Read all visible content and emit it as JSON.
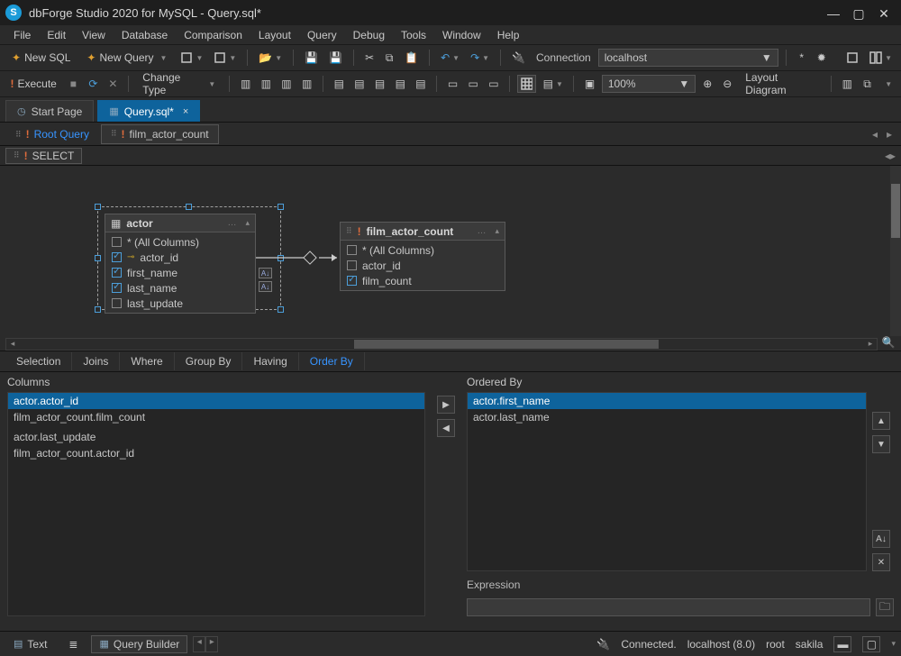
{
  "window": {
    "title": "dbForge Studio 2020 for MySQL - Query.sql*",
    "logo_text": "S"
  },
  "menu": [
    "File",
    "Edit",
    "View",
    "Database",
    "Comparison",
    "Layout",
    "Query",
    "Debug",
    "Tools",
    "Window",
    "Help"
  ],
  "toolbar1": {
    "new_sql": "New SQL",
    "new_query": "New Query",
    "connection_label": "Connection",
    "connection_value": "localhost"
  },
  "toolbar2": {
    "execute": "Execute",
    "change_type": "Change Type",
    "zoom": "100%",
    "layout_diagram": "Layout Diagram"
  },
  "doctabs": {
    "start": "Start Page",
    "active": "Query.sql*"
  },
  "querytabs": {
    "root": "Root Query",
    "sub": "film_actor_count"
  },
  "select_label": "SELECT",
  "tables": {
    "actor": {
      "name": "actor",
      "rows": [
        {
          "label": "* (All Columns)",
          "checked": false,
          "key": false
        },
        {
          "label": "actor_id",
          "checked": true,
          "key": true
        },
        {
          "label": "first_name",
          "checked": true,
          "key": false
        },
        {
          "label": "last_name",
          "checked": true,
          "key": false
        },
        {
          "label": "last_update",
          "checked": false,
          "key": false
        }
      ]
    },
    "film_actor_count": {
      "name": "film_actor_count",
      "rows": [
        {
          "label": "* (All Columns)",
          "checked": false
        },
        {
          "label": "actor_id",
          "checked": false
        },
        {
          "label": "film_count",
          "checked": true
        }
      ]
    }
  },
  "bottom_tabs": [
    "Selection",
    "Joins",
    "Where",
    "Group By",
    "Having",
    "Order By"
  ],
  "orderby": {
    "columns_title": "Columns",
    "orderedby_title": "Ordered By",
    "expression_title": "Expression",
    "columns": [
      "actor.actor_id",
      "film_actor_count.film_count",
      "",
      "actor.last_update",
      "film_actor_count.actor_id"
    ],
    "ordered": [
      "actor.first_name",
      "actor.last_name"
    ]
  },
  "footer": {
    "text": "Text",
    "qb": "Query Builder",
    "connected": "Connected.",
    "server": "localhost (8.0)",
    "user": "root",
    "db": "sakila"
  }
}
